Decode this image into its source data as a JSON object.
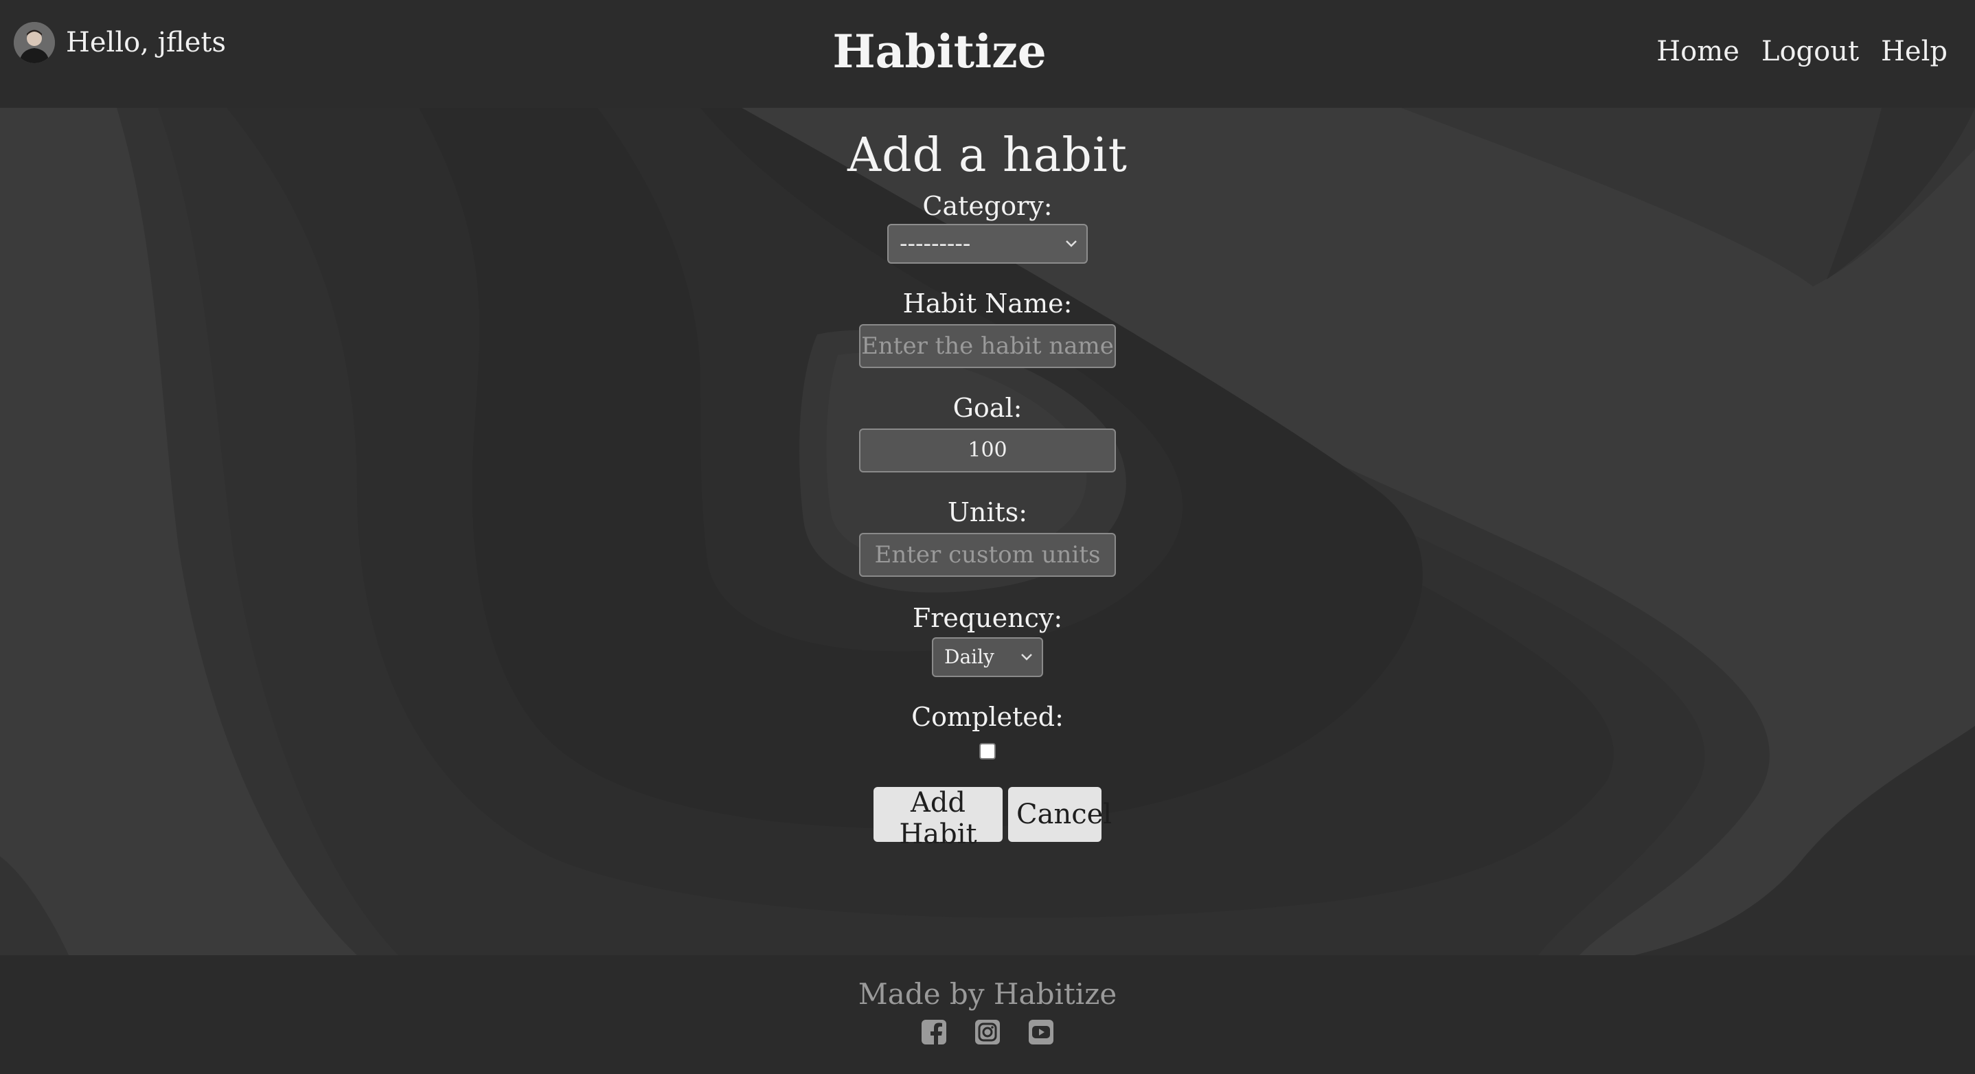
{
  "header": {
    "greeting": "Hello, jflets",
    "brand": "Habitize",
    "nav": [
      "Home",
      "Logout",
      "Help"
    ]
  },
  "form": {
    "title": "Add a habit",
    "category": {
      "label": "Category:",
      "value": "---------"
    },
    "habit_name": {
      "label": "Habit Name:",
      "placeholder": "Enter the habit name",
      "value": ""
    },
    "goal": {
      "label": "Goal:",
      "value": "100"
    },
    "units": {
      "label": "Units:",
      "placeholder": "Enter custom units",
      "value": ""
    },
    "frequency": {
      "label": "Frequency:",
      "value": "Daily"
    },
    "completed": {
      "label": "Completed:",
      "checked": false
    },
    "add_label": "Add Habit",
    "cancel_label": "Cancel"
  },
  "footer": {
    "credit": "Made by Habitize",
    "socials": [
      "facebook-icon",
      "instagram-icon",
      "youtube-icon"
    ]
  },
  "colors": {
    "header_bg": "#2c2c2c",
    "background": "#3a3a3a",
    "button_bg": "#e4e4e4"
  }
}
